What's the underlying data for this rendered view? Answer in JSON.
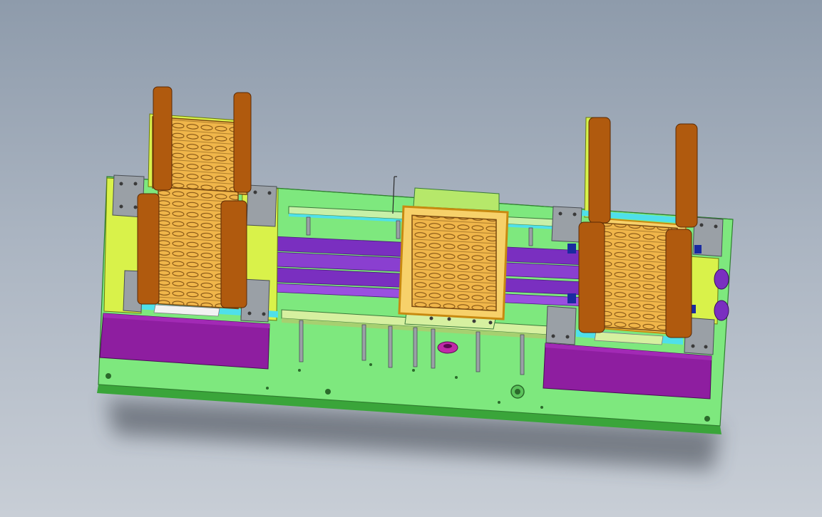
{
  "scene": {
    "kind": "cad-render",
    "subject": "tray-stacker-machine",
    "background_colors": [
      "#8e9bab",
      "#c8ced6"
    ]
  },
  "colors": {
    "base_plate": "#7ee87e",
    "base_plate_edge": "#3aa53a",
    "purple_block": "#8e1ea0",
    "violet_rail": "#7a2fc0",
    "orange_post": "#b05a0e",
    "tray_fill": "#f0b64a",
    "tray_line": "#7a4a10",
    "yellow_green": "#d9f24a",
    "grey_block": "#9aa0a6",
    "cyan_strip": "#4fe0ea",
    "dark_bolt": "#3a3a3a"
  }
}
